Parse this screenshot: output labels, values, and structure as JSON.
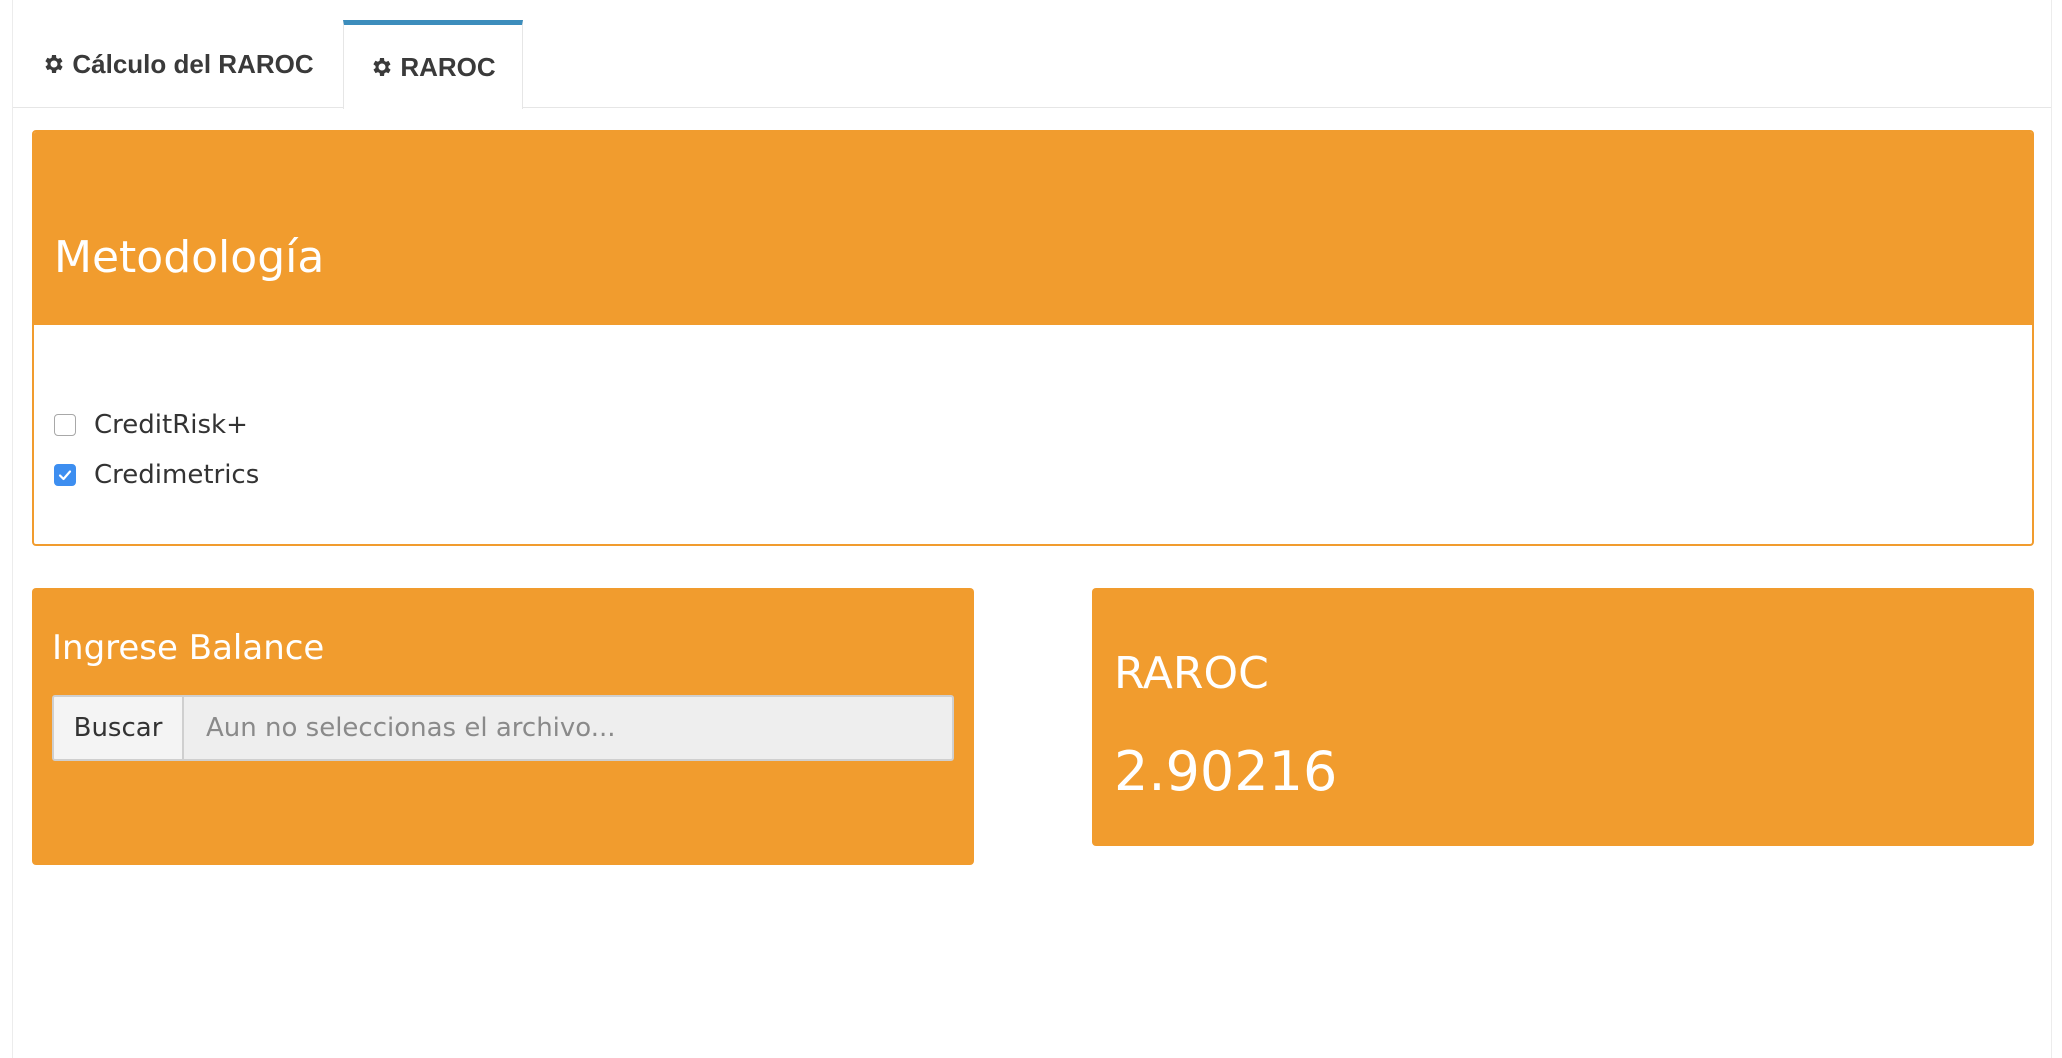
{
  "tabs": [
    {
      "label": "Cálculo del RAROC",
      "icon": "gear-icon",
      "active": false
    },
    {
      "label": "RAROC",
      "icon": "gear-icon",
      "active": true
    }
  ],
  "methodology": {
    "title": "Metodología",
    "options": [
      {
        "label": "CreditRisk+",
        "checked": false
      },
      {
        "label": "Credimetrics",
        "checked": true
      }
    ]
  },
  "balance": {
    "title": "Ingrese Balance",
    "browse_label": "Buscar",
    "file_placeholder": "Aun no seleccionas el archivo..."
  },
  "raroc": {
    "title": "RAROC",
    "value": "2.90216"
  },
  "colors": {
    "accent": "#f19c2e",
    "tab_active": "#3c8dbc",
    "checkbox_checked": "#3d8ef0"
  }
}
